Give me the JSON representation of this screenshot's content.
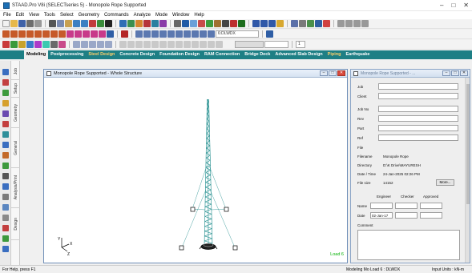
{
  "window": {
    "title": "STAAD.Pro V8i (SELECTseries 5) - Monopole Rope Supported",
    "controls": [
      "–",
      "□",
      "✕"
    ]
  },
  "menu": [
    "File",
    "Edit",
    "View",
    "Tools",
    "Select",
    "Geometry",
    "Commands",
    "Analyze",
    "Mode",
    "Window",
    "Help"
  ],
  "toolbar": {
    "load_combo": "6:DLWDX",
    "unit_combo": "1"
  },
  "ribbon": {
    "tabs": [
      {
        "label": "Modeling",
        "active": true
      },
      {
        "label": "Postprocessing"
      },
      {
        "label": "Steel Design",
        "alt": true
      },
      {
        "label": "Concrete Design"
      },
      {
        "label": "Foundation Design"
      },
      {
        "label": "RAM Connection"
      },
      {
        "label": "Bridge Deck"
      },
      {
        "label": "Advanced Slab Design"
      },
      {
        "label": "Piping",
        "alt": true
      },
      {
        "label": "Earthquake"
      }
    ]
  },
  "side_tabs": [
    "Job",
    "Setup",
    "Geometry",
    "General",
    "Analysis/Print",
    "Design"
  ],
  "view": {
    "title": "Monopole Rope Supported - Whole Structure",
    "load_label": "Load 6",
    "axis_labels": [
      "Y",
      "X",
      "Z"
    ]
  },
  "properties": {
    "title": "Monopole Rope Supported - ...",
    "fields": {
      "job": "Job",
      "client": "Client",
      "job_no": "Job No",
      "rev": "Rev",
      "part": "Part",
      "ref": "Ref",
      "file": "File",
      "filename_label": "Filename",
      "filename_value": "Monopole Rope",
      "directory_label": "Directory",
      "directory_value": "D:\\K Drive\\MAYURESH",
      "datetime_label": "Date / Time",
      "datetime_value": "24-Jan-2025   02:26 PM",
      "filesize_label": "File size",
      "filesize_value": "14152",
      "more_label": "More...",
      "engineer": "Engineer",
      "checker": "Checker",
      "approved": "Approved",
      "name": "Name",
      "date_label": "Date",
      "date_value": "02-Jan-17",
      "comment": "Comment"
    }
  },
  "status": {
    "help": "For Help, press F1",
    "mode": "Modeling Mo  Load 6 : DLWDX",
    "units": "Input Units : kN-m"
  },
  "colors": {
    "ribbon": "#1e7f85",
    "tower": "#1a8a8a",
    "load_label": "#00b000"
  }
}
